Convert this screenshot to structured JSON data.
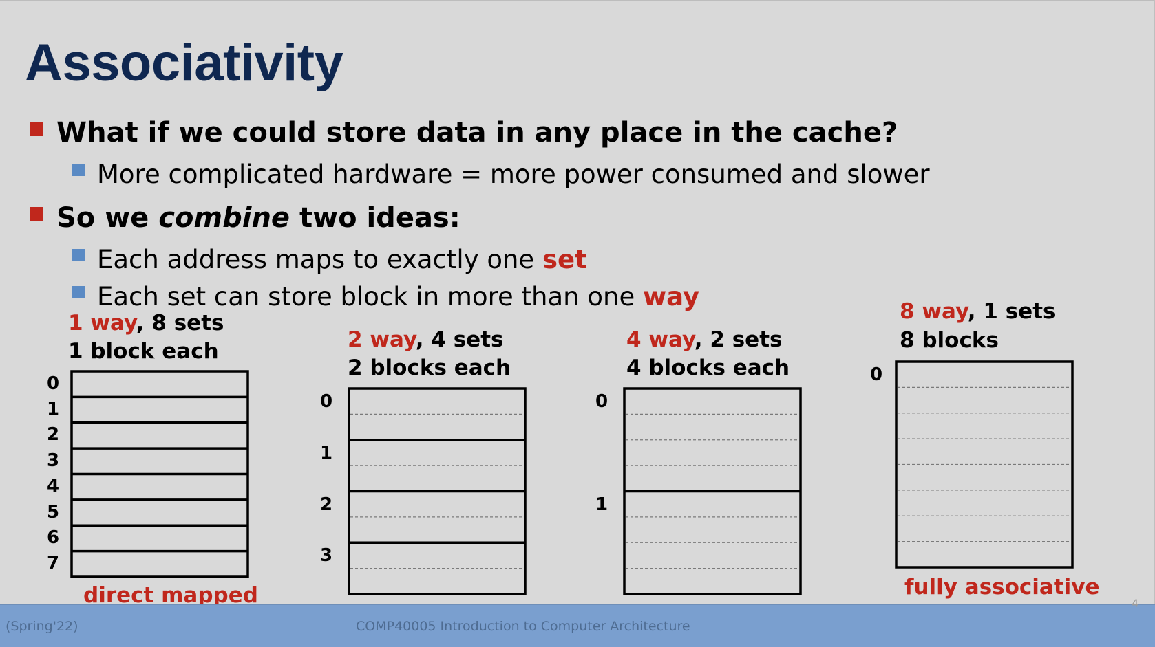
{
  "title": "Associativity",
  "bullets": {
    "b1": "What if we could store data in any place in the cache?",
    "b1_sub1": "More complicated hardware = more power consumed and slower",
    "b2_pre": "So we ",
    "b2_em": "combine",
    "b2_post": " two ideas:",
    "b2_sub1_pre": "Each address maps to exactly one ",
    "b2_sub1_hl": "set",
    "b2_sub2_pre": "Each set can store block in more than one ",
    "b2_sub2_hl": "way"
  },
  "caches": [
    {
      "way_hl": "1 way",
      "sets_text": ", 8 sets",
      "blocks_text": "1 block each",
      "caption": "direct mapped",
      "indices": [
        "0",
        "1",
        "2",
        "3",
        "4",
        "5",
        "6",
        "7"
      ],
      "ways": 1,
      "sets": 8
    },
    {
      "way_hl": "2 way",
      "sets_text": ", 4 sets",
      "blocks_text": "2 blocks each",
      "caption": "",
      "indices": [
        "0",
        "1",
        "2",
        "3"
      ],
      "ways": 2,
      "sets": 4
    },
    {
      "way_hl": "4 way",
      "sets_text": ", 2 sets",
      "blocks_text": "4 blocks each",
      "caption": "",
      "indices": [
        "0",
        "1"
      ],
      "ways": 4,
      "sets": 2
    },
    {
      "way_hl": "8 way",
      "sets_text": ", 1 sets",
      "blocks_text": "8 blocks",
      "caption": "fully associative",
      "indices": [
        "0"
      ],
      "ways": 8,
      "sets": 1
    }
  ],
  "footer": {
    "left": "(Spring'22)",
    "center": "COMP40005 Introduction to Computer Architecture",
    "page": "4"
  }
}
